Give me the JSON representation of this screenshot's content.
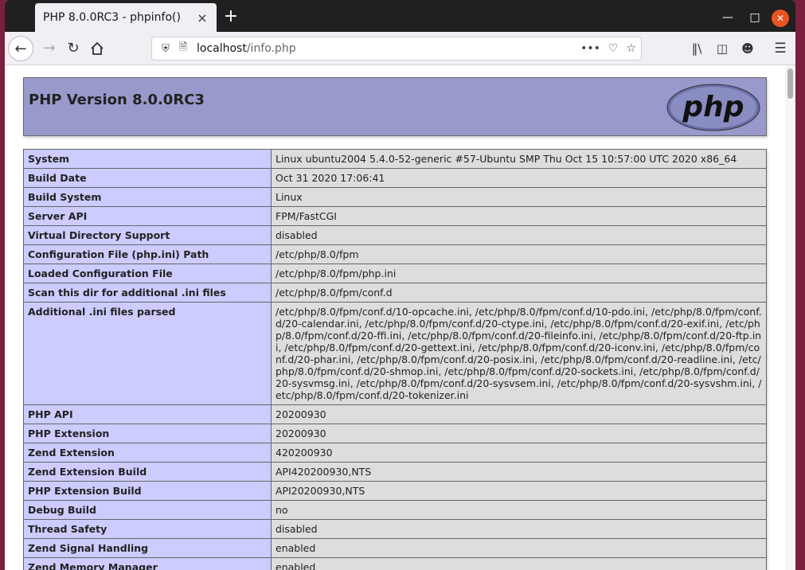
{
  "browser": {
    "tab_title": "PHP 8.0.0RC3 - phpinfo()",
    "tab_close": "×",
    "new_tab": "+",
    "url_host": "localhost",
    "url_path": "/info.php"
  },
  "page": {
    "title": "PHP Version 8.0.0RC3",
    "logo_text": "php",
    "rows": [
      {
        "key": "System",
        "value": "Linux ubuntu2004 5.4.0-52-generic #57-Ubuntu SMP Thu Oct 15 10:57:00 UTC 2020 x86_64"
      },
      {
        "key": "Build Date",
        "value": "Oct 31 2020 17:06:41"
      },
      {
        "key": "Build System",
        "value": "Linux"
      },
      {
        "key": "Server API",
        "value": "FPM/FastCGI"
      },
      {
        "key": "Virtual Directory Support",
        "value": "disabled"
      },
      {
        "key": "Configuration File (php.ini) Path",
        "value": "/etc/php/8.0/fpm"
      },
      {
        "key": "Loaded Configuration File",
        "value": "/etc/php/8.0/fpm/php.ini"
      },
      {
        "key": "Scan this dir for additional .ini files",
        "value": "/etc/php/8.0/fpm/conf.d"
      },
      {
        "key": "Additional .ini files parsed",
        "value": "/etc/php/8.0/fpm/conf.d/10-opcache.ini, /etc/php/8.0/fpm/conf.d/10-pdo.ini, /etc/php/8.0/fpm/conf.d/20-calendar.ini, /etc/php/8.0/fpm/conf.d/20-ctype.ini, /etc/php/8.0/fpm/conf.d/20-exif.ini, /etc/php/8.0/fpm/conf.d/20-ffi.ini, /etc/php/8.0/fpm/conf.d/20-fileinfo.ini, /etc/php/8.0/fpm/conf.d/20-ftp.ini, /etc/php/8.0/fpm/conf.d/20-gettext.ini, /etc/php/8.0/fpm/conf.d/20-iconv.ini, /etc/php/8.0/fpm/conf.d/20-phar.ini, /etc/php/8.0/fpm/conf.d/20-posix.ini, /etc/php/8.0/fpm/conf.d/20-readline.ini, /etc/php/8.0/fpm/conf.d/20-shmop.ini, /etc/php/8.0/fpm/conf.d/20-sockets.ini, /etc/php/8.0/fpm/conf.d/20-sysvmsg.ini, /etc/php/8.0/fpm/conf.d/20-sysvsem.ini, /etc/php/8.0/fpm/conf.d/20-sysvshm.ini, /etc/php/8.0/fpm/conf.d/20-tokenizer.ini"
      },
      {
        "key": "PHP API",
        "value": "20200930"
      },
      {
        "key": "PHP Extension",
        "value": "20200930"
      },
      {
        "key": "Zend Extension",
        "value": "420200930"
      },
      {
        "key": "Zend Extension Build",
        "value": "API420200930,NTS"
      },
      {
        "key": "PHP Extension Build",
        "value": "API20200930,NTS"
      },
      {
        "key": "Debug Build",
        "value": "no"
      },
      {
        "key": "Thread Safety",
        "value": "disabled"
      },
      {
        "key": "Zend Signal Handling",
        "value": "enabled"
      },
      {
        "key": "Zend Memory Manager",
        "value": "enabled"
      }
    ]
  },
  "colors": {
    "header_bg": "#9999cc",
    "key_bg": "#ccccff",
    "value_bg": "#dddddd"
  }
}
